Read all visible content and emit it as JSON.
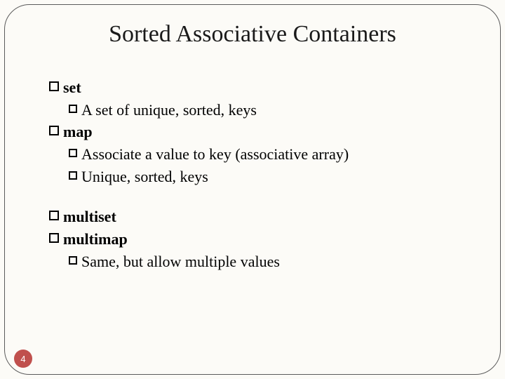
{
  "title": "Sorted Associative Containers",
  "items": {
    "set": {
      "label": "set",
      "desc": "A set of unique, sorted, keys"
    },
    "map": {
      "label": "map",
      "desc1": "Associate a value to key (associative array)",
      "desc2": "Unique, sorted, keys"
    },
    "multiset": {
      "label": "multiset"
    },
    "multimap": {
      "label": "multimap",
      "desc": "Same, but allow multiple values"
    }
  },
  "page_number": "4"
}
